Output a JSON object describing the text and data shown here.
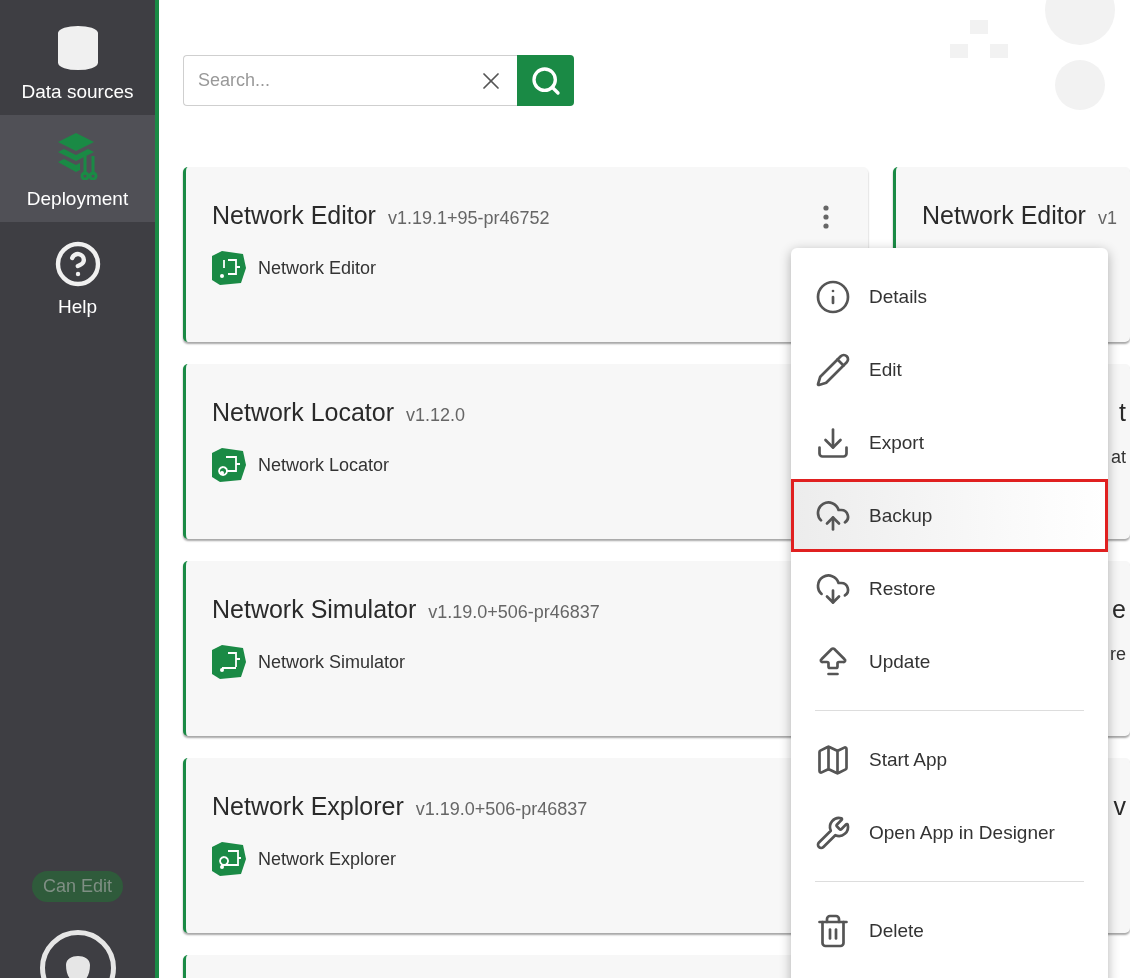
{
  "sidebar": {
    "items": [
      {
        "label": "Data sources",
        "selected": false
      },
      {
        "label": "Deployment",
        "selected": true
      },
      {
        "label": "Help",
        "selected": false
      }
    ],
    "badge": "Can Edit"
  },
  "search": {
    "placeholder": "Search..."
  },
  "cards": [
    {
      "title": "Network Editor",
      "version": "v1.19.1+95-pr46752",
      "app_name": "Network Editor",
      "menu_button": true
    },
    {
      "title": "Network Locator",
      "version": "v1.12.0",
      "app_name": "Network Locator"
    },
    {
      "title": "Network Simulator",
      "version": "v1.19.0+506-pr46837",
      "app_name": "Network Simulator"
    },
    {
      "title": "Network Explorer",
      "version": "v1.19.0+506-pr46837",
      "app_name": "Network Explorer"
    }
  ],
  "cards_column_2": [
    {
      "title": "Network Editor",
      "version": "v1"
    },
    {
      "title": "t",
      "app_name": "at"
    },
    {
      "title": "e",
      "app_name": "re"
    },
    {
      "title": "v"
    }
  ],
  "menu": {
    "groups": [
      [
        {
          "label": "Details",
          "selected": false
        },
        {
          "label": "Edit",
          "selected": false
        },
        {
          "label": "Export",
          "selected": false
        },
        {
          "label": "Backup",
          "selected": true
        },
        {
          "label": "Restore",
          "selected": false
        },
        {
          "label": "Update",
          "selected": false
        }
      ],
      [
        {
          "label": "Start App",
          "selected": false
        },
        {
          "label": "Open App in Designer",
          "selected": false
        }
      ],
      [
        {
          "label": "Delete",
          "selected": false
        }
      ]
    ]
  }
}
